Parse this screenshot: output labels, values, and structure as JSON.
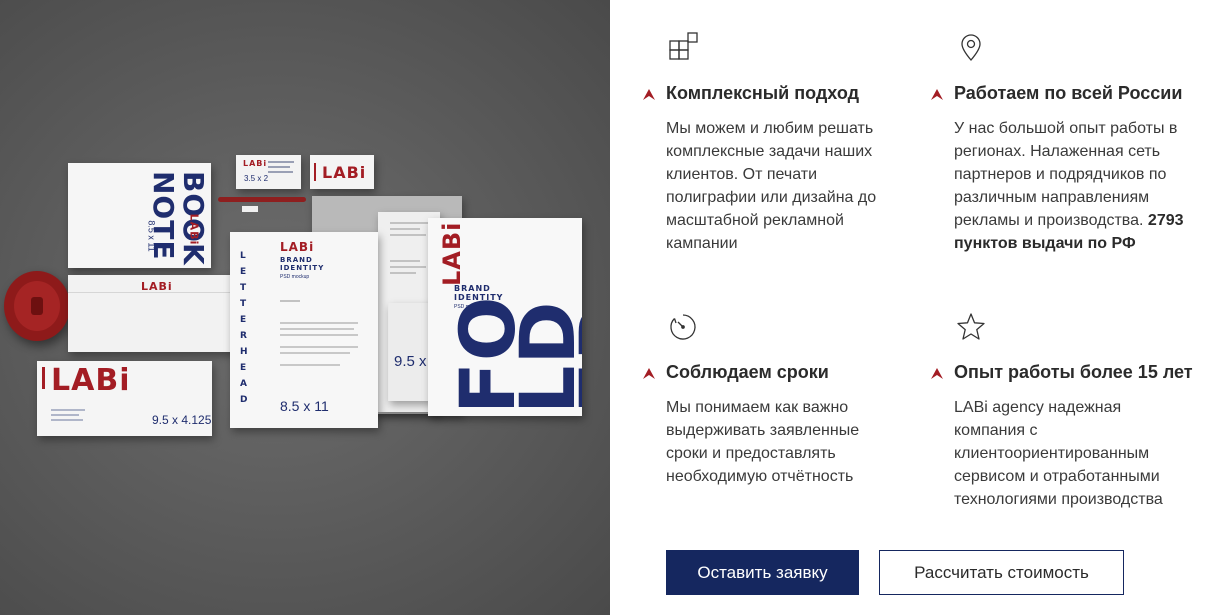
{
  "mockup": {
    "notebook": {
      "title_line1": "NOTE",
      "title_line2": "BOOK",
      "logo": "LABi",
      "size": "8.5 x 11"
    },
    "business_card_small": {
      "logo": "LABi",
      "size": "3.5 x 2"
    },
    "business_card_big": {
      "logo": "LABi"
    },
    "envelope_small": {
      "logo": "LABi"
    },
    "envelope_large": {
      "logo": "LABi",
      "size": "9.5 x 4.125"
    },
    "letterhead": {
      "logo": "LABi",
      "brand": "BRAND IDENTITY",
      "sub": "PSD mockup",
      "vertical": "LETTERHEAD",
      "size": "8.5 x 11"
    },
    "folder": {
      "logo": "LABi",
      "brand": "BRAND IDENTITY",
      "sub": "PSD mockup",
      "word": "FOLDER"
    },
    "back_sheet": {
      "size": "9.5 x"
    }
  },
  "features": [
    {
      "icon": "blocks-icon",
      "title": "Комплексный подход",
      "desc": "Мы можем и любим решать комплексные задачи наших клиентов. От печати полиграфии или дизайна до масштабной рекламной кампании",
      "desc_bold": ""
    },
    {
      "icon": "location-pin-icon",
      "title": "Работаем по всей России",
      "desc": "У нас большой опыт работы в регионах. Налаженная сеть партнеров и подрядчиков по различным направлениям рекламы и производства.",
      "desc_bold": "2793 пунктов выдачи по РФ"
    },
    {
      "icon": "clock-icon",
      "title": "Соблюдаем сроки",
      "desc": "Мы понимаем как важно выдерживать заявленные сроки и предоставлять необходимую отчётность",
      "desc_bold": ""
    },
    {
      "icon": "star-icon",
      "title": "Опыт работы более 15 лет",
      "desc": "LABi agency надежная компания с клиентоориентированным сервисом и отработанными технологиями производства",
      "desc_bold": ""
    }
  ],
  "buttons": {
    "primary": "Оставить заявку",
    "secondary": "Рассчитать стоимость"
  },
  "colors": {
    "navy": "#15275f",
    "accent_red": "#a31d24",
    "mockup_bg": "#5a5a5a"
  }
}
